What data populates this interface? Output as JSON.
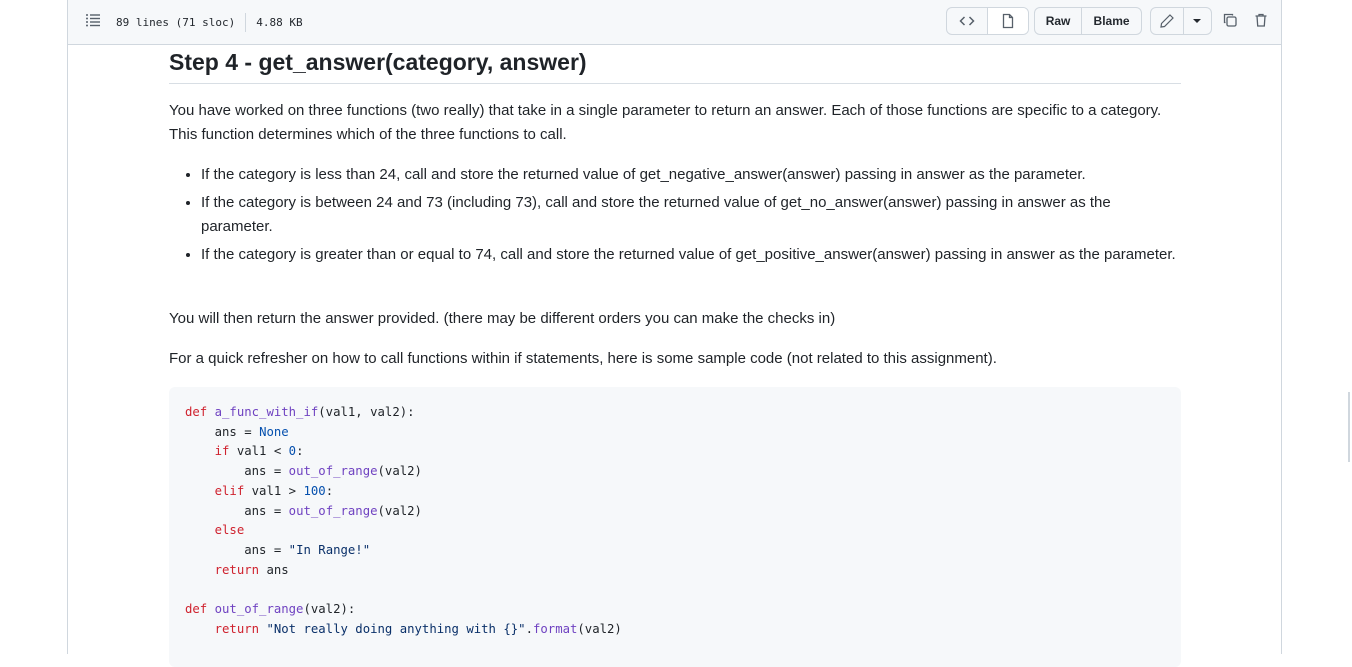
{
  "file_header": {
    "lines_info": "89 lines (71 sloc)",
    "size": "4.88 KB",
    "raw_label": "Raw",
    "blame_label": "Blame"
  },
  "doc": {
    "heading": "Step 4 - get_answer(category, answer)",
    "intro": "You have worked on three functions (two really) that take in a single parameter to return an answer. Each of those functions are specific to a category. This function determines which of the three functions to call.",
    "bullets": [
      "If the category is less than 24, call and store the returned value of get_negative_answer(answer) passing in answer as the parameter.",
      "If the category is between 24 and 73 (including 73), call and store the returned value of get_no_answer(answer) passing in answer as the parameter.",
      "If the category is greater than or equal to 74, call and store the returned value of get_positive_answer(answer) passing in answer as the parameter."
    ],
    "return_note": "You will then return the answer provided. (there may be different orders you can make the checks in)",
    "refresher": "For a quick refresher on how to call functions within if statements, here is some sample code (not related to this assignment)."
  },
  "code": {
    "tokens": {
      "def": "def",
      "func1": "a_func_with_if",
      "params1": "(val1, val2):",
      "ans": "ans",
      "eq": " = ",
      "none": "None",
      "if": "if",
      "cond1": " val1 < ",
      "zero": "0",
      "colon": ":",
      "oor": "out_of_range",
      "arg": "(val2)",
      "elif": "elif",
      "cond2": " val1 > ",
      "hundred": "100",
      "else": "else",
      "in_range": "\"In Range!\"",
      "return": "return",
      "ret_ans": " ans",
      "params2": "(val2):",
      "not_really": "\"Not really doing anything with {}\"",
      "dot": ".",
      "format": "format"
    }
  },
  "colors": {
    "keyword": "#cf222e",
    "function": "#6f42c1",
    "builtin": "#0550ae",
    "string": "#0a3069"
  }
}
